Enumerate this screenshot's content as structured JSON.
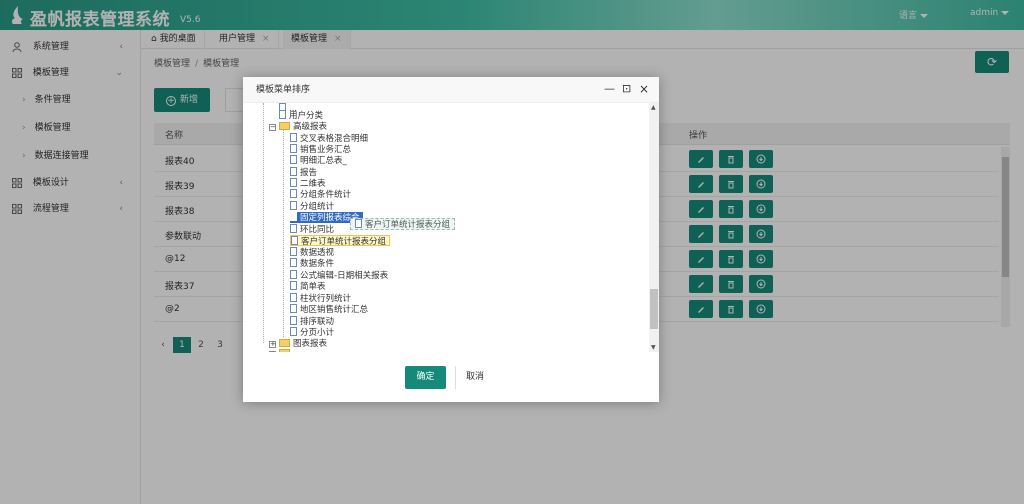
{
  "header": {
    "title": "盈帆报表管理系统",
    "version": "V5.6",
    "language_label": "语言",
    "user_label": "admin"
  },
  "sidebar": {
    "items": [
      {
        "label": "系统管理",
        "arrow": "‹"
      },
      {
        "label": "模板管理",
        "arrow": "⌄"
      },
      {
        "label": "模板设计",
        "arrow": "‹"
      },
      {
        "label": "流程管理",
        "arrow": "‹"
      }
    ],
    "subitems": [
      {
        "label": "条件管理"
      },
      {
        "label": "模板管理"
      },
      {
        "label": "数据连接管理"
      }
    ]
  },
  "tabs": [
    {
      "label": "我的桌面"
    },
    {
      "label": "用户管理"
    },
    {
      "label": "模板管理"
    }
  ],
  "breadcrumb": {
    "root": "模板管理",
    "sep": "/",
    "current": "模板管理"
  },
  "toolbar": {
    "add_label": "新增"
  },
  "table": {
    "headers": {
      "name": "名称",
      "ops": "操作"
    },
    "rows": [
      {
        "name": "报表40"
      },
      {
        "name": "报表39"
      },
      {
        "name": "报表38"
      },
      {
        "name": "参数联动"
      },
      {
        "name": "@12"
      },
      {
        "name": "报表37"
      },
      {
        "name": "@2"
      }
    ]
  },
  "pager": {
    "prev": "‹",
    "pages": [
      "1",
      "2",
      "3"
    ]
  },
  "dialog": {
    "title": "模板菜单排序",
    "min": "—",
    "max": "⊡",
    "close": "×",
    "tree": {
      "n0": "...",
      "n1": "用户分类",
      "folder1": "高级报表",
      "items": [
        "交叉表格混合明细",
        "销售业务汇总",
        "明细汇总表_",
        "报告",
        "二维表",
        "分组条件统计",
        "分组统计"
      ],
      "selected": "固定列报表综合",
      "ghost": "客户订单统计报表分组",
      "after_sel": "环比同比",
      "highlight": "客户订单统计报表分组",
      "items2": [
        "数据透视",
        "数据条件",
        "公式编辑-日期相关报表",
        "简单表",
        "柱状行列统计",
        "地区销售统计汇总",
        "排序联动",
        "分页小计"
      ],
      "folder2": "图表报表",
      "folder3": "..."
    },
    "ok_label": "确定",
    "cancel_label": "取消"
  }
}
